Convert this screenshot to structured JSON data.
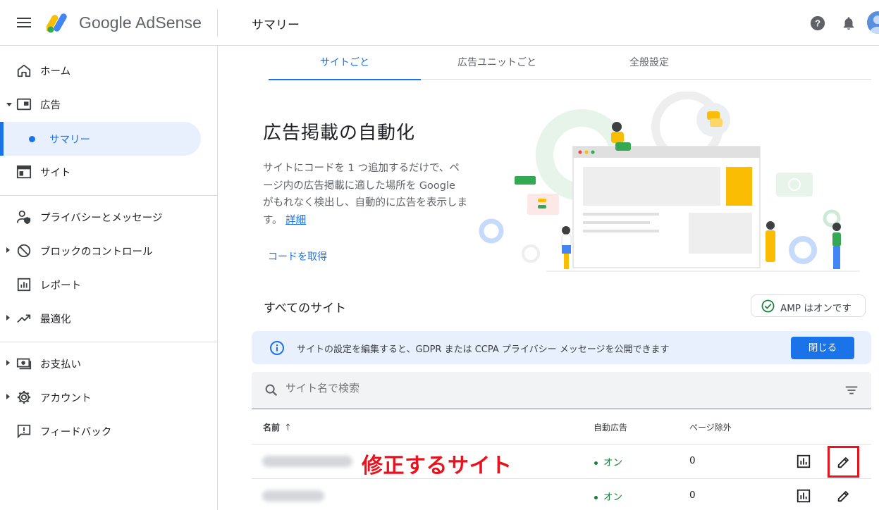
{
  "header": {
    "brand": "Google AdSense",
    "page_title": "サマリー"
  },
  "sidebar": {
    "items": [
      {
        "label": "ホーム",
        "icon": "home-icon"
      },
      {
        "label": "広告",
        "icon": "ads-icon"
      },
      {
        "label": "サマリー",
        "icon": "dot-icon"
      },
      {
        "label": "サイト",
        "icon": "sites-icon"
      },
      {
        "label": "プライバシーとメッセージ",
        "icon": "privacy-icon"
      },
      {
        "label": "ブロックのコントロール",
        "icon": "block-icon"
      },
      {
        "label": "レポート",
        "icon": "report-icon"
      },
      {
        "label": "最適化",
        "icon": "trending-icon"
      },
      {
        "label": "お支払い",
        "icon": "payments-icon"
      },
      {
        "label": "アカウント",
        "icon": "gear-icon"
      },
      {
        "label": "フィードバック",
        "icon": "feedback-icon"
      }
    ]
  },
  "tabs": [
    {
      "label": "サイトごと",
      "active": true
    },
    {
      "label": "広告ユニットごと",
      "active": false
    },
    {
      "label": "全般設定",
      "active": false
    }
  ],
  "hero": {
    "title": "広告掲載の自動化",
    "body": "サイトにコードを 1 つ追加するだけで、ページ内の広告掲載に適した場所を Google がもれなく検出し、自動的に広告を表示します。",
    "link": "詳細",
    "get_code": "コードを取得"
  },
  "sites": {
    "title": "すべてのサイト",
    "amp_chip": "AMP はオンです",
    "banner_text": "サイトの設定を編集すると、GDPR または CCPA プライバシー メッセージを公開できます",
    "banner_button": "閉じる",
    "search_placeholder": "サイト名で検索",
    "columns": {
      "name": "名前",
      "auto_ads": "自動広告",
      "page_exclusions": "ページ除外"
    },
    "rows": [
      {
        "status": "オン",
        "exclusions": "0"
      },
      {
        "status": "オン",
        "exclusions": "0"
      }
    ],
    "annotation": "修正するサイト"
  },
  "colors": {
    "accent": "#1a73e8",
    "annotation": "#e8131c",
    "status_on": "#188038"
  }
}
